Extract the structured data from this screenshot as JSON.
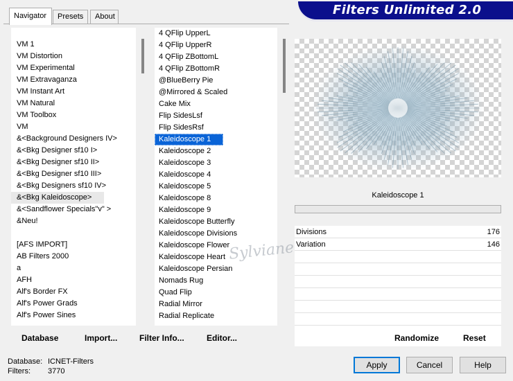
{
  "tabs": [
    "Navigator",
    "Presets",
    "About"
  ],
  "title": "Filters Unlimited 2.0",
  "categories": [
    "VM 1",
    "VM Distortion",
    "VM Experimental",
    "VM Extravaganza",
    "VM Instant Art",
    "VM Natural",
    "VM Toolbox",
    "VM",
    "&<Background Designers IV>",
    "&<Bkg Designer sf10 I>",
    "&<Bkg Designer sf10 II>",
    "&<Bkg Designer sf10 III>",
    "&<Bkg Designers sf10 IV>",
    "&<Bkg Kaleidoscope>",
    "&<Sandflower Specials\"v\" >",
    "&Neu!",
    "",
    "[AFS IMPORT]",
    "AB Filters 2000",
    "a",
    "AFH",
    "Alf's Border FX",
    "Alf's Power Grads",
    "Alf's Power Sines"
  ],
  "filters": [
    "4 QFlip UpperL",
    "4 QFlip UpperR",
    "4 QFlip ZBottomL",
    "4 QFlip ZBottomR",
    "@BlueBerry Pie",
    "@Mirrored & Scaled",
    "Cake Mix",
    "Flip SidesLsf",
    "Flip SidesRsf",
    "Kaleidoscope 1",
    "Kaleidoscope 2",
    "Kaleidoscope 3",
    "Kaleidoscope 4",
    "Kaleidoscope 5",
    "Kaleidoscope 8",
    "Kaleidoscope 9",
    "Kaleidoscope Butterfly",
    "Kaleidoscope Divisions",
    "Kaleidoscope Flower",
    "Kaleidoscope Heart",
    "Kaleidoscope Persian",
    "Nomads Rug",
    "Quad Flip",
    "Radial Mirror",
    "Radial Replicate"
  ],
  "selected_category": "&<Bkg Kaleidoscope>",
  "selected_filter": "Kaleidoscope 1",
  "preview_label": "Kaleidoscope 1",
  "parameters": [
    {
      "label": "Divisions",
      "value": "176"
    },
    {
      "label": "Variation",
      "value": "146"
    }
  ],
  "actions": {
    "database": "Database",
    "import": "Import...",
    "filter_info": "Filter Info...",
    "editor": "Editor...",
    "randomize": "Randomize",
    "reset": "Reset"
  },
  "buttons": {
    "apply": "Apply",
    "cancel": "Cancel",
    "help": "Help"
  },
  "status": {
    "database_label": "Database:",
    "database_value": "ICNET-Filters",
    "filters_label": "Filters:",
    "filters_value": "3770"
  },
  "watermark": "Sylviane",
  "colors": {
    "banner": "#0b0f8c",
    "selection": "#0a64d7"
  }
}
